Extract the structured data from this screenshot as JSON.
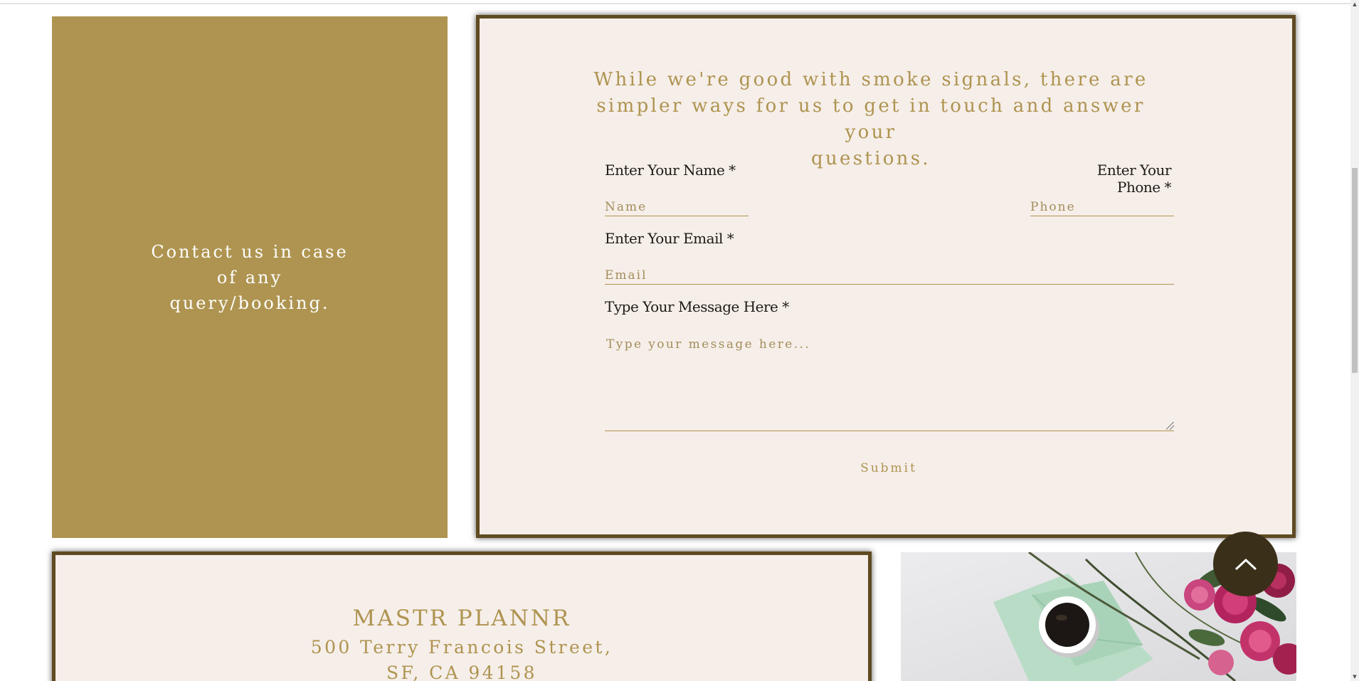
{
  "colors": {
    "gold": "#ae9450",
    "cream": "#f6eee9",
    "dark_brown": "#3a3019",
    "border_brown": "#5f4a22"
  },
  "contact_panel": {
    "message_lines": [
      "Contact us in case",
      "of any",
      "query/booking."
    ]
  },
  "form": {
    "heading_lines": [
      "While we're good with smoke signals, there are",
      "simpler ways for us to get in touch and answer your",
      "questions."
    ],
    "name_label": "Enter Your Name *",
    "name_placeholder": "Name",
    "phone_label": "Enter Your Phone *",
    "phone_placeholder": "Phone",
    "email_label": "Enter Your Email *",
    "email_placeholder": "Email",
    "message_label": "Type Your Message Here *",
    "message_placeholder": "Type your message here...",
    "submit_label": "Submit"
  },
  "address": {
    "brand": "MASTR PLANNR",
    "street": "500 Terry Francois Street,",
    "city": "SF, CA 94158"
  },
  "icons": {
    "back_to_top": "chevron-up-icon",
    "scroll_up": "triangle-up-icon",
    "scroll_down": "triangle-down-icon"
  }
}
